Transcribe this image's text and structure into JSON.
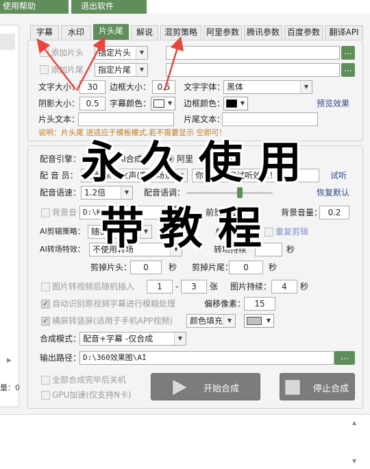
{
  "menu": {
    "help": "使用帮助",
    "exit": "退出软件"
  },
  "left_panel": {
    "arrow": "▶",
    "text": "量：0"
  },
  "tabs": [
    "字幕",
    "水印",
    "片头尾",
    "解说",
    "混剪策略",
    "阿里参数",
    "腾讯参数",
    "百度参数",
    "翻译API"
  ],
  "active_tab": "片头尾",
  "intro_outro": {
    "add_intro_label": "添加片头",
    "add_intro_select": "指定片头",
    "add_outro_label": "添加片尾",
    "add_outro_select": "指定片尾",
    "browse": "...",
    "font_size_label": "文字大小：",
    "font_size_value": "30",
    "border_size_label": "边框大小：",
    "border_size_value": "0.5",
    "font_family_label": "文字字体：",
    "font_family_value": "黑体",
    "shadow_size_label": "阴影大小：",
    "shadow_size_value": "0.5",
    "subtitle_color_label": "字幕颜色：",
    "subtitle_color": "#ffffff",
    "border_color_label": "边框颜色：",
    "border_color": "#000000",
    "preview": "预览效果",
    "intro_text_label": "片头文本：",
    "outro_text_label": "片尾文本：",
    "note": "说明：片头尾    进适应于模板模式,若不需要显示   空即可！"
  },
  "dubbing": {
    "engine_label": "配音引擎：",
    "engine_opt1": "讯语音AI合成",
    "engine_opt2": "阿里",
    "engine_opt3": "I",
    "voice_label": "配 音 员：",
    "voice_value": "艾夏-亲和女声(客服场景)",
    "sample_text": "你好，欢迎试听效果！",
    "listen": "试听",
    "speed_label": "配音语速：",
    "speed_value": "1.2倍",
    "pitch_label": "配音语调：",
    "pitch_level": 0.62,
    "reset": "恢复默认",
    "bgm_label": "背景音",
    "bgm_path": "D:\\Ku",
    "fg_volume_label": "前景音量",
    "bg_volume_label": "背景音量：",
    "bg_volume_value": "0.2",
    "ai_cut_label": "AI剪辑策略：",
    "ai_cut_value": "随机",
    "unit_label": "单位",
    "recut": "重复剪辑",
    "ai_trans_label": "AI转场特效：",
    "ai_trans_value": "不使用转场",
    "trans_duration_label": "转场持续",
    "trans_unit": "秒",
    "cut_intro_label": "剪掉片头：",
    "cut_intro_value": "0",
    "cut_outro_label": "剪掉片尾：",
    "cut_outro_value": "0",
    "sec": "秒",
    "img_insert_label": "图片转视频后随机插入",
    "img_from": "1",
    "img_to": "3",
    "img_unit": "张",
    "img_dur_label": "图片持续：",
    "img_dur_value": "4",
    "auto_blur_label": "自动识别原视频字幕进行模糊处理",
    "offset_label": "偏移像素：",
    "offset_value": "15",
    "h2v_label": "横屏转竖屏(适用于手机APP视频)",
    "fill_value": "颜色填充",
    "fill_color": "#c0c0c0",
    "compose_mode_label": "合成模式：",
    "compose_mode_value": "配音+字幕 -仅合成",
    "output_label": "输出路径：",
    "output_path": "D:\\360效果图\\AI",
    "shutdown_label": "全部合成完毕后关机",
    "gpu_label": "GPU加速(仅支持N卡)",
    "start": "开始合成",
    "stop": "停止合成"
  },
  "watermark": {
    "line1": "永久使用",
    "line2": "带教程"
  },
  "colors": {
    "accent": "#5f8e5a",
    "annotation_arrow": "#e8463c"
  }
}
